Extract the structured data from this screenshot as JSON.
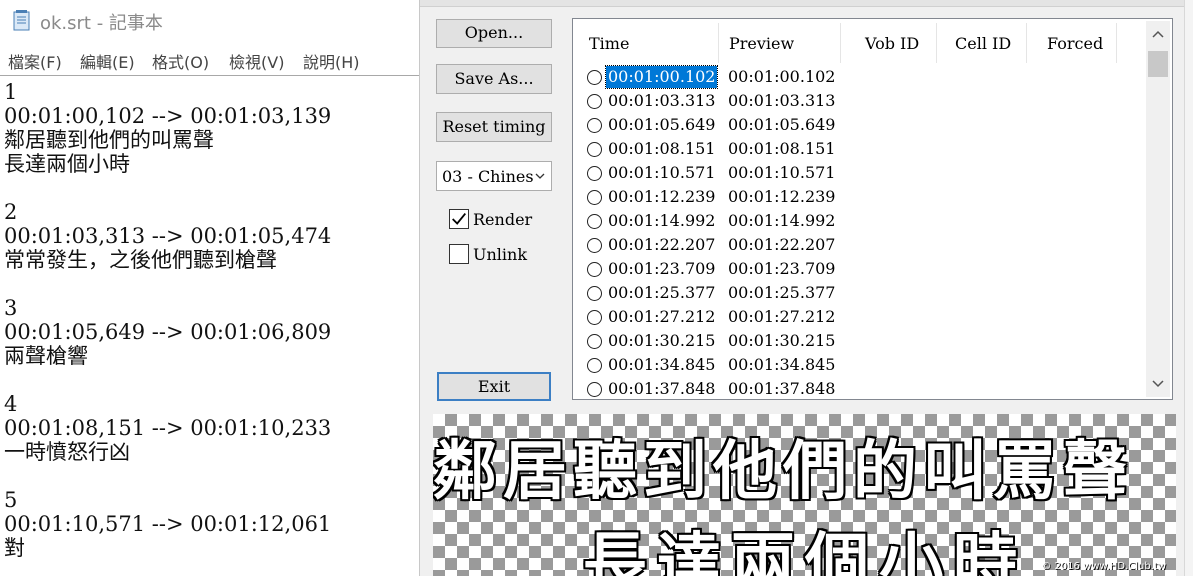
{
  "notepad": {
    "title": "ok.srt - 記事本",
    "menu": [
      "檔案(F)",
      "編輯(E)",
      "格式(O)",
      "檢視(V)",
      "說明(H)"
    ],
    "lines": [
      "1",
      "00:01:00,102 --> 00:01:03,139",
      "鄰居聽到他們的叫罵聲",
      "長達兩個小時",
      "",
      "2",
      "00:01:03,313 --> 00:01:05,474",
      "常常發生，之後他們聽到槍聲",
      "",
      "3",
      "00:01:05,649 --> 00:01:06,809",
      "兩聲槍響",
      "",
      "4",
      "00:01:08,151 --> 00:01:10,233",
      "一時憤怒行凶",
      "",
      "5",
      "00:01:10,571 --> 00:01:12,061",
      "對"
    ]
  },
  "tool": {
    "buttons": {
      "open": "Open...",
      "save_as": "Save As...",
      "reset_timing": "Reset timing",
      "exit": "Exit"
    },
    "stream_select": "03 - Chines",
    "render": {
      "label": "Render",
      "checked": true
    },
    "unlink": {
      "label": "Unlink",
      "checked": false
    },
    "list": {
      "columns": [
        "Time",
        "Preview",
        "Vob ID",
        "Cell ID",
        "Forced"
      ],
      "rows": [
        {
          "time": "00:01:00.102",
          "preview": "00:01:00.102",
          "selected": true
        },
        {
          "time": "00:01:03.313",
          "preview": "00:01:03.313"
        },
        {
          "time": "00:01:05.649",
          "preview": "00:01:05.649"
        },
        {
          "time": "00:01:08.151",
          "preview": "00:01:08.151"
        },
        {
          "time": "00:01:10.571",
          "preview": "00:01:10.571"
        },
        {
          "time": "00:01:12.239",
          "preview": "00:01:12.239"
        },
        {
          "time": "00:01:14.992",
          "preview": "00:01:14.992"
        },
        {
          "time": "00:01:22.207",
          "preview": "00:01:22.207"
        },
        {
          "time": "00:01:23.709",
          "preview": "00:01:23.709"
        },
        {
          "time": "00:01:25.377",
          "preview": "00:01:25.377"
        },
        {
          "time": "00:01:27.212",
          "preview": "00:01:27.212"
        },
        {
          "time": "00:01:30.215",
          "preview": "00:01:30.215"
        },
        {
          "time": "00:01:34.845",
          "preview": "00:01:34.845"
        },
        {
          "time": "00:01:37.848",
          "preview": "00:01:37.848"
        }
      ]
    },
    "preview": {
      "line1": "鄰居聽到他們的叫罵聲",
      "line2": "長達兩個小時",
      "watermark": "© 2016 www.HD.Club.tw"
    },
    "colors": {
      "selection": "#0078d7",
      "exit_border": "#3c7fc4"
    }
  }
}
